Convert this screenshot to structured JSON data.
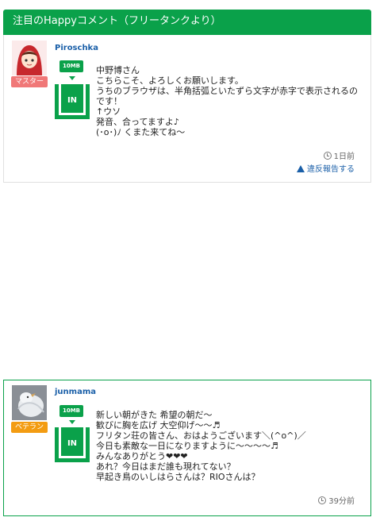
{
  "header": {
    "title": "注目のHappyコメント（フリータンクより）"
  },
  "colors": {
    "accent": "#0aa14a",
    "link": "#1a5fa8",
    "master_badge": "#f07878",
    "veteran_badge": "#f39c12"
  },
  "comments": [
    {
      "username": "Piroschka",
      "role": "マスター",
      "avatar_icon": "girl-red-hood-icon",
      "size_tag": "10MB",
      "in_label": "IN",
      "lines": [
        "中野博さん",
        "こちらこそ、よろしくお願いします。",
        "うちのブラウザは、半角括弧といたずら文字が赤字で表示されるの",
        "です！",
        "↑ウソ",
        "発音、合ってますよ♪",
        "(･o･)ﾉ くまた来てね〜"
      ],
      "time": "1日前",
      "report_label": "違反報告する"
    },
    {
      "username": "junmama",
      "role": "ベテラン",
      "avatar_icon": "white-bird-icon",
      "size_tag": "10MB",
      "in_label": "IN",
      "lines": [
        "新しい朝がきた 希望の朝だ〜",
        "歓びに胸を広げ 大空仰げ〜〜♬",
        "フリタン荘の皆さん、おはようございます＼(^o^)／",
        "今日も素敵な一日になりますように〜〜〜〜♬",
        "みんなありがとう❤❤❤",
        "あれ？今日はまだ誰も現れてない？",
        "早起き鳥のいしはらさんは？RIOさんは？"
      ],
      "time": "39分前"
    }
  ]
}
